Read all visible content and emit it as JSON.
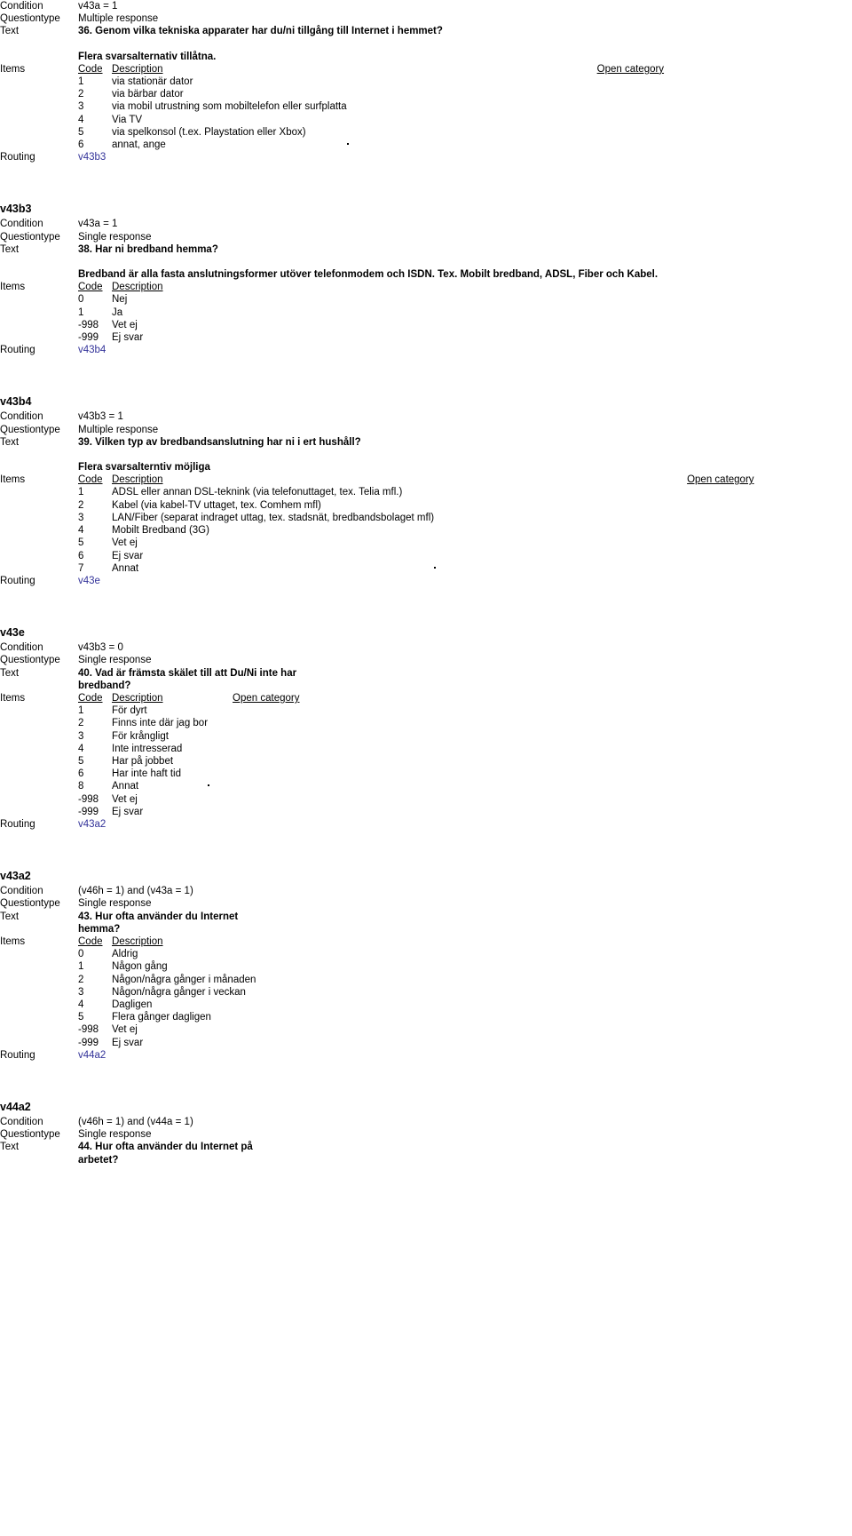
{
  "labels": {
    "condition": "Condition",
    "questiontype": "Questiontype",
    "text": "Text",
    "items": "Items",
    "routing": "Routing",
    "code": "Code",
    "description": "Description",
    "open_category": "Open category"
  },
  "blocks": [
    {
      "name": "",
      "condition": "v43a = 1",
      "questiontype": "Multiple response",
      "text": "36. Genom vilka tekniska apparater har du/ni tillgång till Internet i hemmet?",
      "note": "Flera svarsalternativ tillåtna.",
      "has_open_category": true,
      "items": [
        {
          "code": "1",
          "description": "via stationär dator",
          "open": false
        },
        {
          "code": "2",
          "description": "via bärbar dator",
          "open": false
        },
        {
          "code": "3",
          "description": "via mobil utrustning som mobiltelefon eller surfplatta",
          "open": false
        },
        {
          "code": "4",
          "description": "Via TV",
          "open": false
        },
        {
          "code": "5",
          "description": "via spelkonsol (t.ex. Playstation eller Xbox)",
          "open": false
        },
        {
          "code": "6",
          "description": "annat, ange",
          "open": true
        }
      ],
      "routing": "v43b3"
    },
    {
      "name": "v43b3",
      "condition": "v43a = 1",
      "questiontype": "Single response",
      "text": "38. Har ni bredband hemma?",
      "note": "Bredband är alla fasta anslutningsformer utöver telefonmodem och ISDN. Tex. Mobilt bredband, ADSL, Fiber och Kabel.",
      "has_open_category": false,
      "items": [
        {
          "code": "0",
          "description": "Nej",
          "open": false
        },
        {
          "code": "1",
          "description": "Ja",
          "open": false
        },
        {
          "code": "-998",
          "description": "Vet ej",
          "open": false
        },
        {
          "code": "-999",
          "description": "Ej svar",
          "open": false
        }
      ],
      "routing": "v43b4"
    },
    {
      "name": "v43b4",
      "condition": "v43b3 = 1",
      "questiontype": "Multiple response",
      "text": "39. Vilken typ av bredbandsanslutning har ni i ert hushåll?",
      "note": "Flera svarsalterntiv möjliga",
      "has_open_category": true,
      "items": [
        {
          "code": "1",
          "description": "ADSL eller annan DSL-teknink (via telefonuttaget, tex. Telia mfl.)",
          "open": false
        },
        {
          "code": "2",
          "description": "Kabel (via kabel-TV uttaget, tex. Comhem mfl)",
          "open": false
        },
        {
          "code": "3",
          "description": "LAN/Fiber (separat indraget uttag, tex. stadsnät, bredbandsbolaget mfl)",
          "open": false
        },
        {
          "code": "4",
          "description": "Mobilt Bredband (3G)",
          "open": false
        },
        {
          "code": "5",
          "description": "Vet ej",
          "open": false
        },
        {
          "code": "6",
          "description": "Ej svar",
          "open": false
        },
        {
          "code": "7",
          "description": "Annat",
          "open": true
        }
      ],
      "routing": "v43e"
    },
    {
      "name": "v43e",
      "condition": "v43b3 = 0",
      "questiontype": "Single response",
      "text": "40. Vad är främsta skälet till att Du/Ni inte har bredband?",
      "note": "",
      "has_open_category": true,
      "items": [
        {
          "code": "1",
          "description": "För dyrt",
          "open": false
        },
        {
          "code": "2",
          "description": "Finns inte där jag bor",
          "open": false
        },
        {
          "code": "3",
          "description": "För krångligt",
          "open": false
        },
        {
          "code": "4",
          "description": "Inte intresserad",
          "open": false
        },
        {
          "code": "5",
          "description": "Har på jobbet",
          "open": false
        },
        {
          "code": "6",
          "description": "Har inte haft tid",
          "open": false
        },
        {
          "code": "8",
          "description": "Annat",
          "open": true
        },
        {
          "code": "-998",
          "description": "Vet ej",
          "open": false
        },
        {
          "code": "-999",
          "description": "Ej svar",
          "open": false
        }
      ],
      "routing": "v43a2"
    },
    {
      "name": "v43a2",
      "condition": "(v46h = 1) and (v43a = 1)",
      "questiontype": "Single response",
      "text": "43. Hur ofta använder du Internet hemma?",
      "note": "",
      "has_open_category": false,
      "items": [
        {
          "code": "0",
          "description": "Aldrig",
          "open": false
        },
        {
          "code": "1",
          "description": "Någon gång",
          "open": false
        },
        {
          "code": "2",
          "description": "Någon/några gånger i månaden",
          "open": false
        },
        {
          "code": "3",
          "description": "Någon/några gånger i veckan",
          "open": false
        },
        {
          "code": "4",
          "description": "Dagligen",
          "open": false
        },
        {
          "code": "5",
          "description": "Flera gånger dagligen",
          "open": false
        },
        {
          "code": "-998",
          "description": "Vet ej",
          "open": false
        },
        {
          "code": "-999",
          "description": "Ej svar",
          "open": false
        }
      ],
      "routing": "v44a2"
    },
    {
      "name": "v44a2",
      "condition": "(v46h = 1) and (v44a = 1)",
      "questiontype": "Single response",
      "text": "44. Hur ofta använder du Internet på arbetet?",
      "note": "",
      "has_open_category": false,
      "items": [],
      "routing": ""
    }
  ]
}
